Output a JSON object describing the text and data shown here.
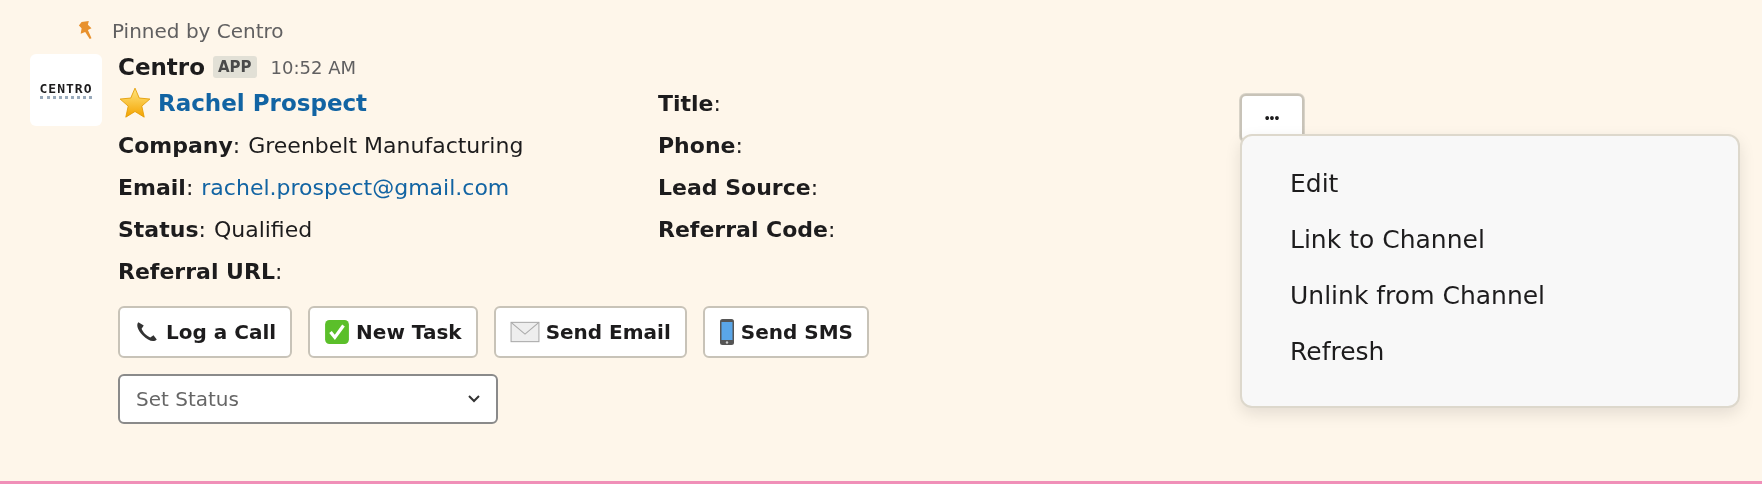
{
  "pinned_by": "Pinned by Centro",
  "avatar": {
    "logo_text": "CENTRO"
  },
  "sender": {
    "name": "Centro",
    "badge": "APP",
    "time": "10:52 AM"
  },
  "record": {
    "title": "Rachel Prospect",
    "starred": true
  },
  "left_fields": [
    {
      "label": "Company",
      "value": "Greenbelt Manufacturing",
      "kind": "text"
    },
    {
      "label": "Email",
      "value": "rachel.prospect@gmail.com",
      "kind": "link"
    },
    {
      "label": "Status",
      "value": "Qualified",
      "kind": "text"
    },
    {
      "label": "Referral URL"
    }
  ],
  "right_fields": [
    {
      "label": "Title"
    },
    {
      "label": "Phone"
    },
    {
      "label": "Lead Source"
    },
    {
      "label": "Referral Code"
    }
  ],
  "separator": ":",
  "actions": [
    {
      "label": "Log a Call",
      "kind": "phone"
    },
    {
      "label": "New Task",
      "kind": "check"
    },
    {
      "label": "Send Email",
      "kind": "envelope"
    },
    {
      "label": "Send SMS",
      "kind": "mobile"
    }
  ],
  "status_select": {
    "placeholder": "Set Status"
  },
  "more_button": {
    "label": "•••",
    "expanded": true
  },
  "menu": [
    "Edit",
    "Link to Channel",
    "Unlink from Channel",
    "Refresh"
  ]
}
